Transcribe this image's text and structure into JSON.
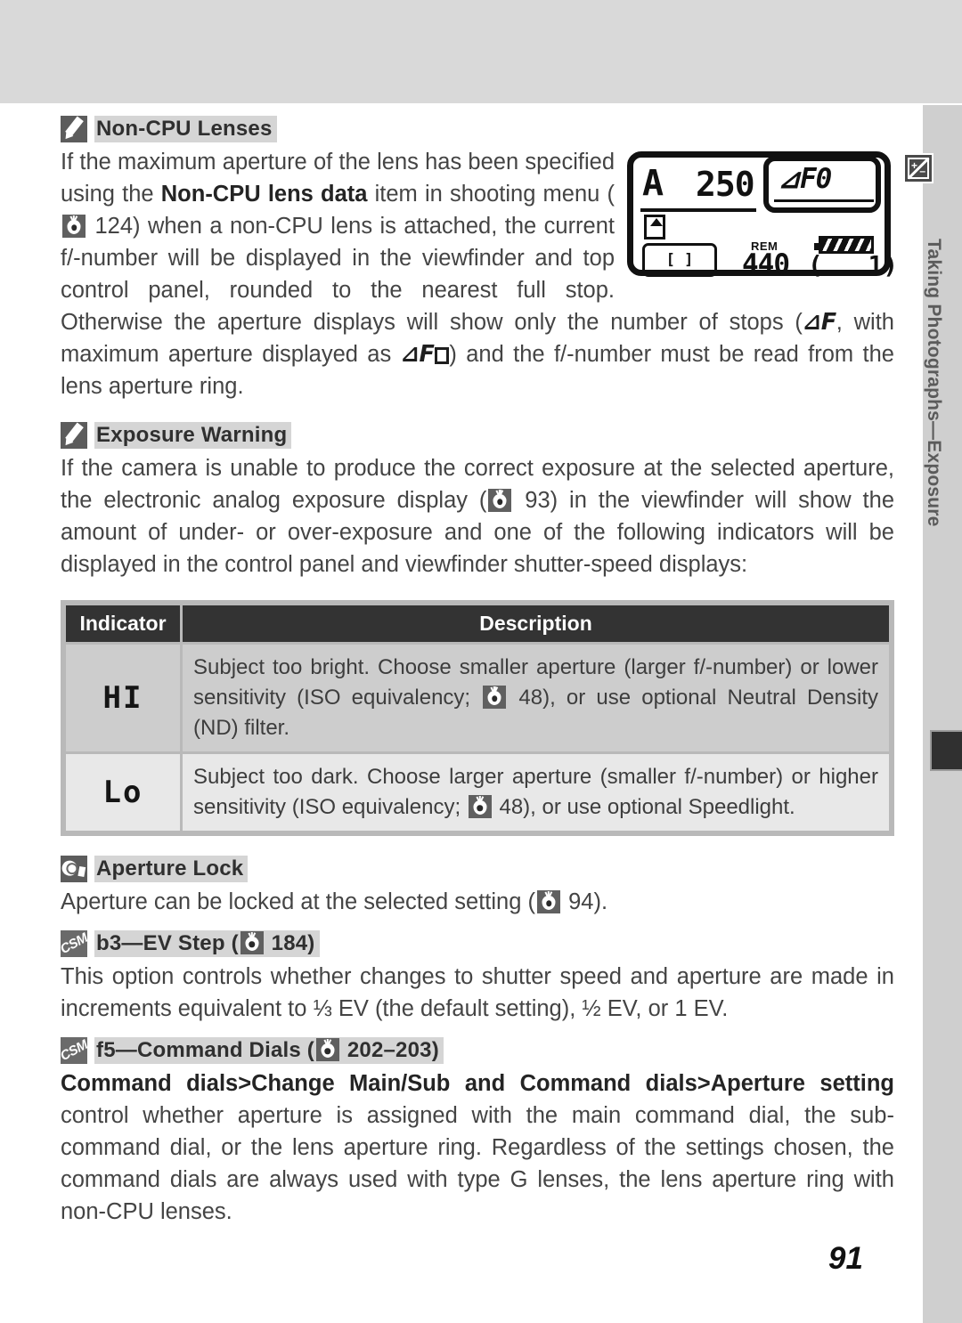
{
  "page": {
    "number": "91",
    "side_tab": {
      "icon": "exposure-compensation-icon",
      "label": "Taking Photographs—Exposure"
    }
  },
  "sections": [
    {
      "id": "non-cpu-lenses",
      "icon": "pencil-icon",
      "title": "Non-CPU Lenses",
      "paragraph_parts": {
        "p1": "If the maximum aperture of the lens has been specified using the ",
        "bold1": "Non-CPU lens data",
        "p2": " item in shooting menu (",
        "ref1": "124",
        "p3": ") when a non-CPU lens is attached, the current f/-number will be displayed in the viewfinder and top control panel, rounded to the nearest full stop.  Otherwise the aperture displays will show only the number of stops (",
        "glyph1": "⊿F",
        "p4": ", with maximum aperture displayed as ",
        "glyph2": "⊿F",
        "p5": ") and the f/-number must be read from the lens aperture ring."
      }
    },
    {
      "id": "exposure-warning",
      "icon": "pencil-icon",
      "title": "Exposure Warning",
      "paragraph_parts": {
        "p1": "If the camera is unable to produce the correct exposure at the selected aperture, the electronic analog exposure display (",
        "ref1": "93",
        "p2": ") in the viewfinder will show the amount of under- or over-exposure and one of the following indicators will be displayed in the control panel and viewfinder shutter-speed displays:"
      }
    },
    {
      "id": "aperture-lock",
      "icon": "magnifier-icon",
      "title": "Aperture Lock",
      "paragraph_parts": {
        "p1": "Aperture can be locked at the selected setting (",
        "ref1": "94",
        "p2": ")."
      }
    },
    {
      "id": "b3-ev-step",
      "icon": "csm-badge-icon",
      "title_prefix": "b3—EV Step (",
      "title_ref": "184",
      "title_suffix": ")",
      "paragraph": "This option controls whether changes to shutter speed and aperture are made in increments equivalent to ⅓ EV (the default setting), ½ EV, or 1 EV."
    },
    {
      "id": "f5-command-dials",
      "icon": "csm-badge-icon",
      "title_prefix": "f5—Command Dials (",
      "title_ref": "202–203",
      "title_suffix": ")",
      "paragraph_parts": {
        "bold1": "Command dials",
        "sep1": ">",
        "bold2": "Change Main/Sub",
        "mid1": " and ",
        "bold3": "Command dials",
        "sep2": ">",
        "bold4": "Aperture setting",
        "rest": " control whether aperture is assigned with the main command dial, the sub-command dial, or the lens aperture ring.  Regardless of the settings chosen, the command dials are always used with type G lenses, the lens aperture ring with non-CPU lenses."
      }
    }
  ],
  "lcd_panel": {
    "mode": "A",
    "shutter_speed": "250",
    "aperture_display": "⊿F0",
    "rem_label": "REM",
    "remaining": "440",
    "frames": "1",
    "frame_bracket_left": "(",
    "frame_bracket_right": ")",
    "viewfinder_brackets": "[ ]"
  },
  "indicator_table": {
    "headers": {
      "indicator": "Indicator",
      "description": "Description"
    },
    "rows": [
      {
        "indicator": "HI",
        "desc_p1": "Subject too bright.  Choose smaller aperture (larger f/-number) or lower sensitivity (ISO equivalency; ",
        "desc_ref": "48",
        "desc_p2": "), or use optional Neutral Density (ND) filter."
      },
      {
        "indicator": "Lo",
        "desc_p1": "Subject too dark.  Choose larger aperture (smaller f/-number) or higher sensitivity (ISO equivalency; ",
        "desc_ref": "48",
        "desc_p2": "), or use optional Speedlight."
      }
    ]
  },
  "colors": {
    "band": "#d9d9d9",
    "heading_highlight": "#d5d5d5",
    "icon_dark": "#5c5c5c",
    "table_header": "#333333",
    "row_hi": "#cdcdcd",
    "row_lo": "#e8e8e8",
    "text": "#444444"
  }
}
